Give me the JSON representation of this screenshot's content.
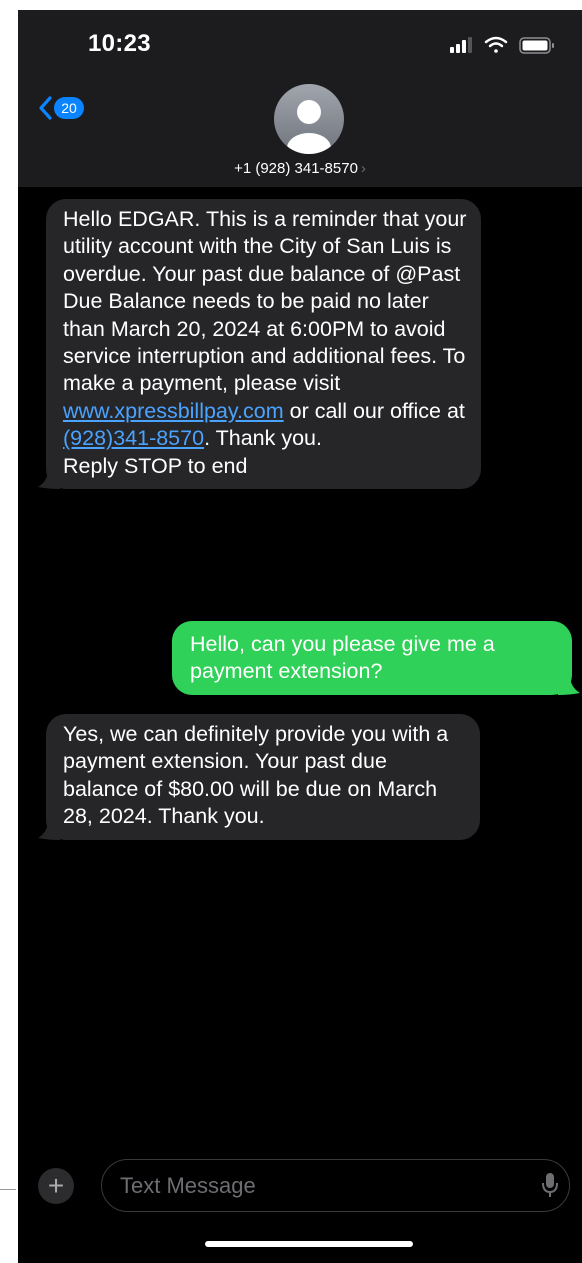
{
  "status": {
    "time": "10:23"
  },
  "nav": {
    "back_count": "20"
  },
  "contact": {
    "phone": "+1 (928) 341-8570",
    "chevron": "›"
  },
  "messages": {
    "m1": {
      "p1": "Hello EDGAR. This is a reminder that your utility account with the City of San Luis is overdue. Your past due balance of @Past Due Balance  needs to be paid no later than March 20, 2024 at 6:00PM to avoid service interruption and additional fees. To make a payment, please visit ",
      "link1": "www.xpressbillpay.com",
      "p2": " or call our office at ",
      "link2": "(928)341-8570",
      "p3": ". Thank you.",
      "p4": "Reply STOP to end"
    },
    "m2": "Hello, can you please give me a payment extension?",
    "m3": "Yes, we can definitely provide you with a payment extension. Your past due balance of $80.00 will be due on March 28, 2024. Thank you."
  },
  "composer": {
    "placeholder": "Text Message",
    "plus": "+"
  },
  "colors": {
    "incoming": "#262628",
    "outgoing": "#30d158",
    "link": "#4aa3ff",
    "badge": "#0a84ff"
  }
}
